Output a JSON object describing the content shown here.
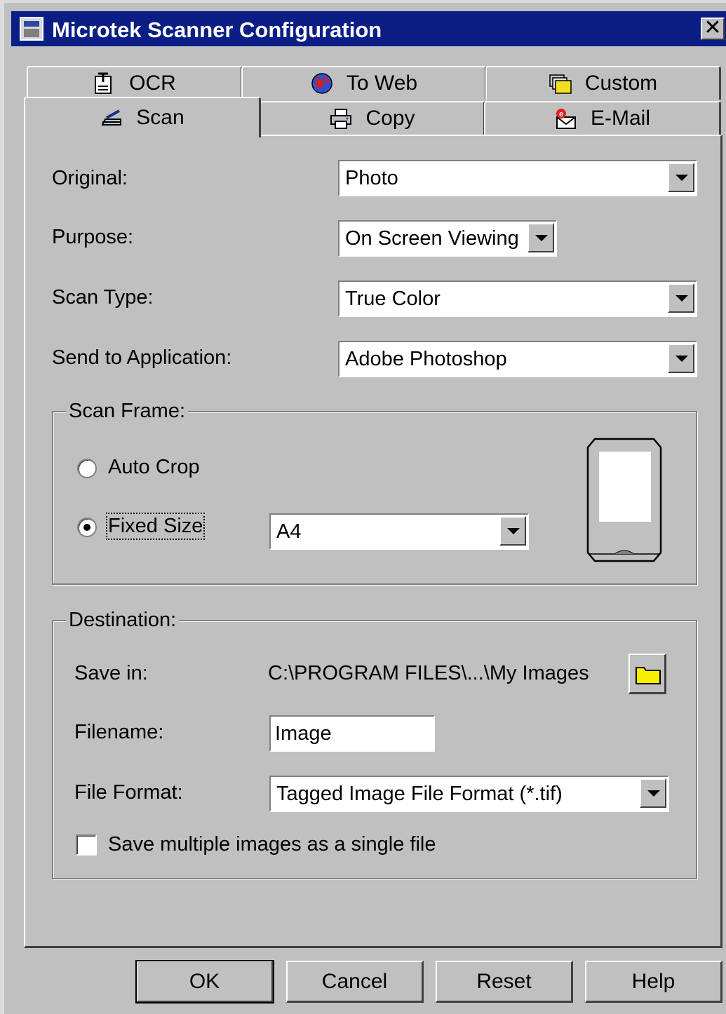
{
  "window": {
    "title": "Microtek Scanner Configuration",
    "close_label": "✕"
  },
  "tabs": {
    "row_top": [
      {
        "label": "OCR",
        "icon": "ocr-document-icon"
      },
      {
        "label": "To Web",
        "icon": "globe-icon"
      },
      {
        "label": "Custom",
        "icon": "folders-icon"
      }
    ],
    "row_bottom": [
      {
        "label": "Scan",
        "icon": "scanner-icon",
        "active": true
      },
      {
        "label": "Copy",
        "icon": "printer-icon"
      },
      {
        "label": "E-Mail",
        "icon": "email-icon"
      }
    ]
  },
  "settings": {
    "original": {
      "label": "Original:",
      "value": "Photo"
    },
    "purpose": {
      "label": "Purpose:",
      "value": "On Screen Viewing"
    },
    "scan_type": {
      "label": "Scan Type:",
      "value": "True Color"
    },
    "send_to": {
      "label": "Send to Application:",
      "value": "Adobe Photoshop"
    }
  },
  "scan_frame": {
    "title": "Scan Frame:",
    "auto_crop": {
      "label": "Auto Crop",
      "selected": false
    },
    "fixed_size": {
      "label": "Fixed Size",
      "selected": true
    },
    "size_value": "A4"
  },
  "destination": {
    "title": "Destination:",
    "save_in": {
      "label": "Save in:",
      "path": "C:\\PROGRAM FILES\\...\\My Images"
    },
    "filename": {
      "label": "Filename:",
      "value": "Image"
    },
    "file_format": {
      "label": "File Format:",
      "value": "Tagged Image File Format (*.tif)"
    },
    "multi_single": {
      "label": "Save multiple images as a single file",
      "checked": false
    }
  },
  "buttons": {
    "ok": "OK",
    "cancel": "Cancel",
    "reset": "Reset",
    "help": "Help"
  }
}
